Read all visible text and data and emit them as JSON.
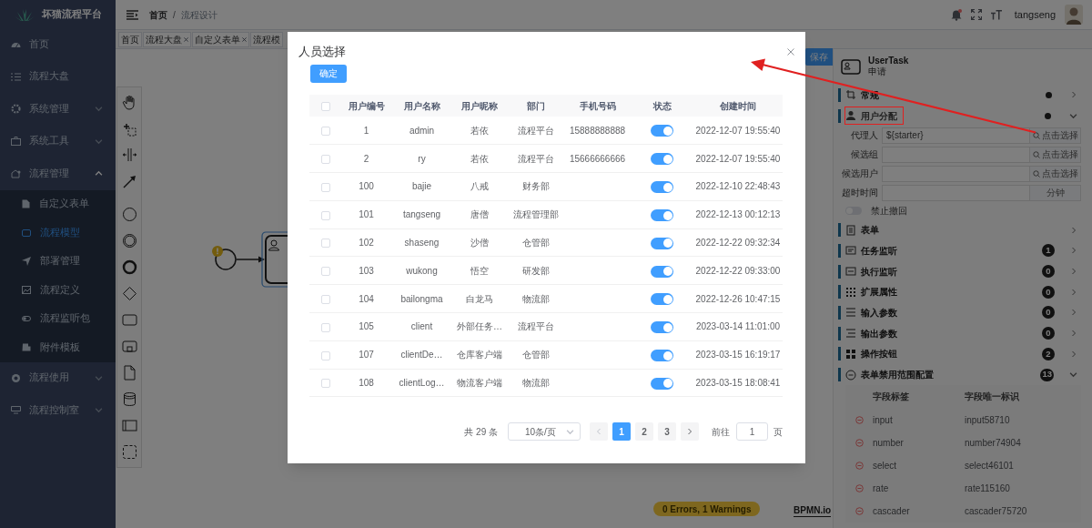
{
  "sidebar": {
    "title": "坏猫流程平台",
    "items": [
      {
        "label": "首页",
        "selected": false
      },
      {
        "label": "流程大盘",
        "selected": false
      },
      {
        "label": "系统管理",
        "expanded": false,
        "selected": false
      },
      {
        "label": "系统工具",
        "expanded": false,
        "selected": false
      },
      {
        "label": "流程管理",
        "expanded": true,
        "selected": false,
        "children": [
          {
            "label": "自定义表单",
            "selected": false
          },
          {
            "label": "流程模型",
            "selected": true
          },
          {
            "label": "部署管理",
            "selected": false
          },
          {
            "label": "流程定义",
            "selected": false
          },
          {
            "label": "流程监听包",
            "selected": false
          },
          {
            "label": "附件模板",
            "selected": false
          }
        ]
      },
      {
        "label": "流程使用",
        "expanded": false,
        "selected": false
      },
      {
        "label": "流程控制室",
        "expanded": false,
        "selected": false
      }
    ]
  },
  "navbar": {
    "breadcrumb": [
      "首页",
      "流程设计"
    ],
    "separator": "/",
    "user": "tangseng"
  },
  "tags": [
    {
      "label": "首页",
      "closable": false
    },
    {
      "label": "流程大盘",
      "closable": true
    },
    {
      "label": "自定义表单",
      "closable": true
    },
    {
      "label": "流程模",
      "closable": false
    }
  ],
  "canvas": {
    "save_button": "保存",
    "status": "0 Errors, 1 Warnings",
    "brand": "BPMN.io"
  },
  "properties": {
    "element_type": "UserTask",
    "element_name": "申请",
    "groups": [
      {
        "label": "常规",
        "dot": true,
        "expanded": false,
        "highlighted": false
      },
      {
        "kind": "assignment",
        "label": "用户分配",
        "dot": true,
        "expanded": true,
        "highlighted": true,
        "fields": [
          {
            "label": "代理人",
            "value": "${starter}",
            "action": "点击选择"
          },
          {
            "label": "候选组",
            "action": "点击选择"
          },
          {
            "label": "候选用户",
            "action": "点击选择"
          },
          {
            "label": "超时时间",
            "suffix": "分钟"
          }
        ],
        "switch": {
          "label": "禁止撤回",
          "on": false
        }
      },
      {
        "label": "表单",
        "dot": false,
        "expanded": false,
        "highlighted": false
      },
      {
        "label": "任务监听",
        "dot": false,
        "badge": "1",
        "expanded": false,
        "highlighted": false
      },
      {
        "label": "执行监听",
        "dot": false,
        "badge": "0",
        "expanded": false,
        "highlighted": false
      },
      {
        "label": "扩展属性",
        "dot": false,
        "badge": "0",
        "expanded": false,
        "highlighted": false
      },
      {
        "label": "输入参数",
        "dot": false,
        "badge": "0",
        "expanded": false,
        "highlighted": false
      },
      {
        "label": "输出参数",
        "dot": false,
        "badge": "0",
        "expanded": false,
        "highlighted": false
      },
      {
        "label": "操作按钮",
        "dot": false,
        "badge": "2",
        "expanded": false,
        "highlighted": false
      },
      {
        "kind": "field_table",
        "label": "表单禁用范围配置",
        "dot": false,
        "badge": "13",
        "expanded": true,
        "highlighted": false,
        "columns": [
          "字段标签",
          "字段唯一标识"
        ],
        "rows": [
          {
            "label": "input",
            "key": "input58710"
          },
          {
            "label": "number",
            "key": "number74904"
          },
          {
            "label": "select",
            "key": "select46101"
          },
          {
            "label": "rate",
            "key": "rate115160"
          },
          {
            "label": "cascader",
            "key": "cascader75720"
          }
        ]
      }
    ]
  },
  "modal": {
    "title": "人员选择",
    "confirm": "确定",
    "header_checked": false,
    "columns": [
      "用户编号",
      "用户名称",
      "用户昵称",
      "部门",
      "手机号码",
      "状态",
      "创建时间"
    ],
    "rows": [
      {
        "checked": false,
        "id": "1",
        "username": "admin",
        "nickname": "若依",
        "dept": "流程平台",
        "phone": "15888888888",
        "on": true,
        "created": "2022-12-07 19:55:40"
      },
      {
        "checked": false,
        "id": "2",
        "username": "ry",
        "nickname": "若依",
        "dept": "流程平台",
        "phone": "15666666666",
        "on": true,
        "created": "2022-12-07 19:55:40"
      },
      {
        "checked": false,
        "id": "100",
        "username": "bajie",
        "nickname": "八戒",
        "dept": "财务部",
        "on": true,
        "created": "2022-12-10 22:48:43"
      },
      {
        "checked": false,
        "id": "101",
        "username": "tangseng",
        "nickname": "唐僧",
        "dept": "流程管理部",
        "on": true,
        "created": "2022-12-13 00:12:13"
      },
      {
        "checked": false,
        "id": "102",
        "username": "shaseng",
        "nickname": "沙僧",
        "dept": "仓管部",
        "on": true,
        "created": "2022-12-22 09:32:34"
      },
      {
        "checked": false,
        "id": "103",
        "username": "wukong",
        "nickname": "悟空",
        "dept": "研发部",
        "on": true,
        "created": "2022-12-22 09:33:00"
      },
      {
        "checked": false,
        "id": "104",
        "username": "bailongma",
        "nickname": "白龙马",
        "dept": "物流部",
        "on": true,
        "created": "2022-12-26 10:47:15"
      },
      {
        "checked": false,
        "id": "105",
        "username": "client",
        "nickname": "外部任务…",
        "dept": "流程平台",
        "on": true,
        "created": "2023-03-14 11:01:00"
      },
      {
        "checked": false,
        "id": "107",
        "username": "clientDe…",
        "nickname": "仓库客户端",
        "dept": "仓管部",
        "on": true,
        "created": "2023-03-15 16:19:17"
      },
      {
        "checked": false,
        "id": "108",
        "username": "clientLog…",
        "nickname": "物流客户端",
        "dept": "物流部",
        "on": true,
        "created": "2023-03-15 18:08:41"
      }
    ],
    "pagination": {
      "total": "共 29 条",
      "page_size": "10条/页",
      "pages": [
        {
          "label": "1",
          "selected": true
        },
        {
          "label": "2",
          "selected": false
        },
        {
          "label": "3",
          "selected": false
        }
      ],
      "goto": "前往",
      "page": "1",
      "unit": "页"
    }
  }
}
